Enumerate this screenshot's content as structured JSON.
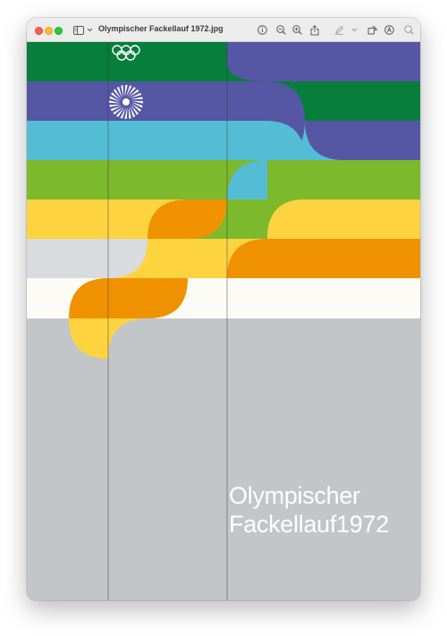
{
  "window": {
    "title": "Olympischer Fackellauf 1972.jpg"
  },
  "toolbar": {
    "icons": [
      "sidebar-icon",
      "chevron-down-icon",
      "info-icon",
      "zoom-out-icon",
      "zoom-in-icon",
      "share-icon",
      "markup-pen-icon",
      "chevron-down-icon",
      "rotate-icon",
      "markup-circle-icon",
      "search-icon"
    ]
  },
  "poster": {
    "line1": "Olympischer",
    "line2": "Fackellauf1972",
    "colors": {
      "green": "#077e3b",
      "violet": "#5557a5",
      "cyan": "#54bdd6",
      "lime": "#7cb92c",
      "yellow": "#fdd340",
      "orange": "#f09200",
      "light_grey": "#d8dcde",
      "cream": "#fdfbf5",
      "grey": "#c2c6c9"
    }
  }
}
